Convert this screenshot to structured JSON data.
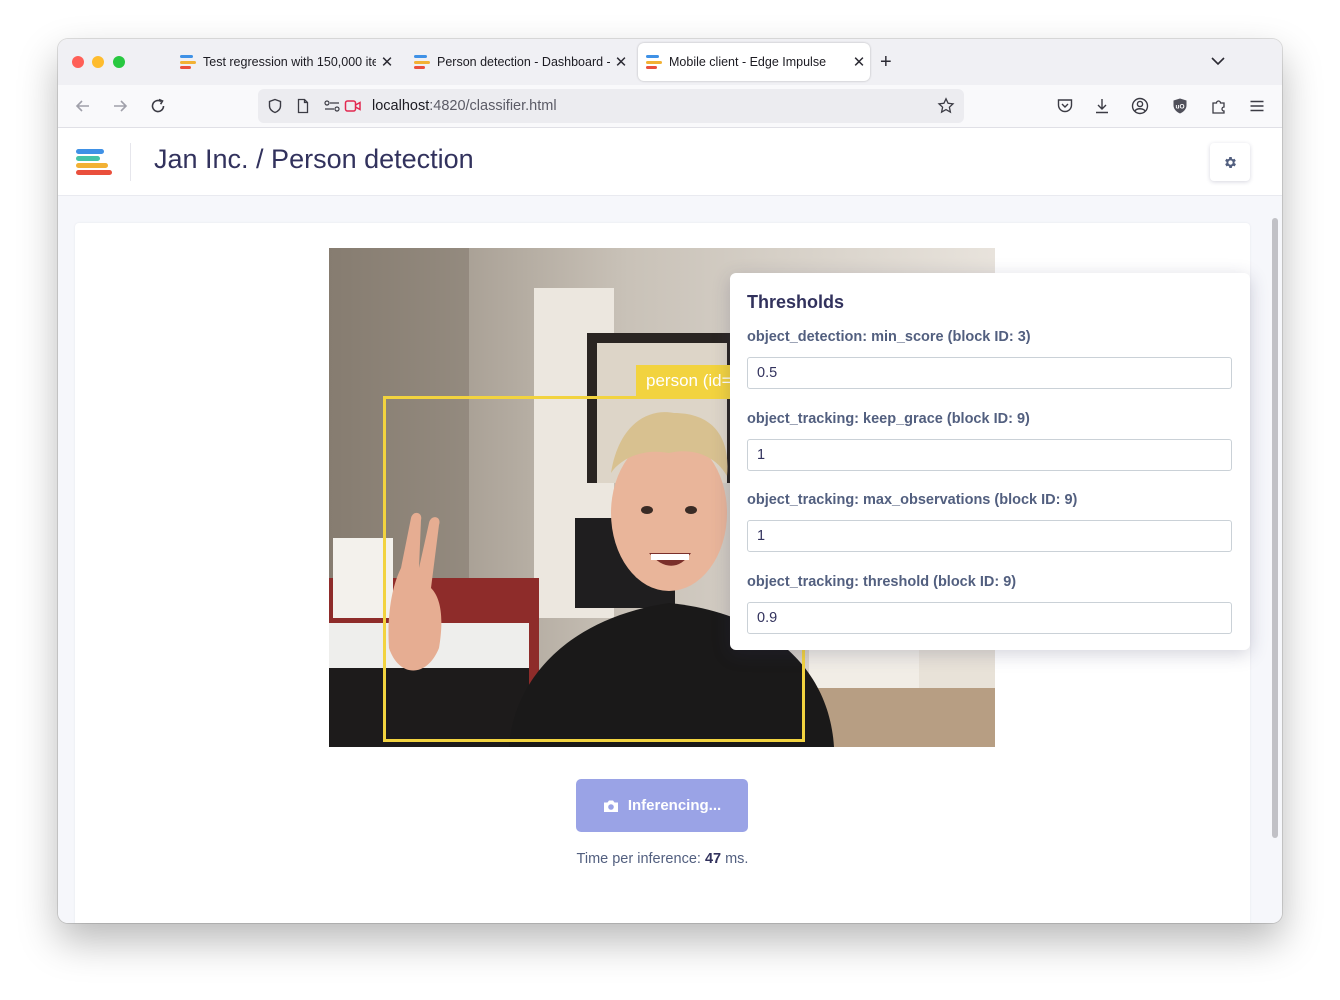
{
  "browser": {
    "tabs": [
      {
        "label": "Test regression with 150,000 ite",
        "close": "✕",
        "active": false
      },
      {
        "label": "Person detection - Dashboard - ",
        "close": "✕",
        "active": false
      },
      {
        "label": "Mobile client - Edge Impulse",
        "close": "✕",
        "active": true
      }
    ],
    "new_tab": "+",
    "url_host": "localhost",
    "url_rest": ":4820/classifier.html"
  },
  "app": {
    "title": "Jan Inc. / Person detection",
    "brand_colors": [
      "#3f91e6",
      "#45c3a7",
      "#f2b134",
      "#ea4f3c"
    ]
  },
  "viewer": {
    "detection_label": "person (id=",
    "inference_button": "Inferencing...",
    "time_prefix": "Time per inference: ",
    "time_value": "47",
    "time_suffix": " ms."
  },
  "thresholds": {
    "title": "Thresholds",
    "fields": [
      {
        "label": "object_detection: min_score (block ID: 3)",
        "value": "0.5"
      },
      {
        "label": "object_tracking: keep_grace (block ID: 9)",
        "value": "1"
      },
      {
        "label": "object_tracking: max_observations (block ID: 9)",
        "value": "1"
      },
      {
        "label": "object_tracking: threshold (block ID: 9)",
        "value": "0.9"
      }
    ]
  },
  "colors": {
    "accent_button": "#9aa3e6",
    "bbox": "#f2d33f",
    "title_text": "#32325d"
  }
}
